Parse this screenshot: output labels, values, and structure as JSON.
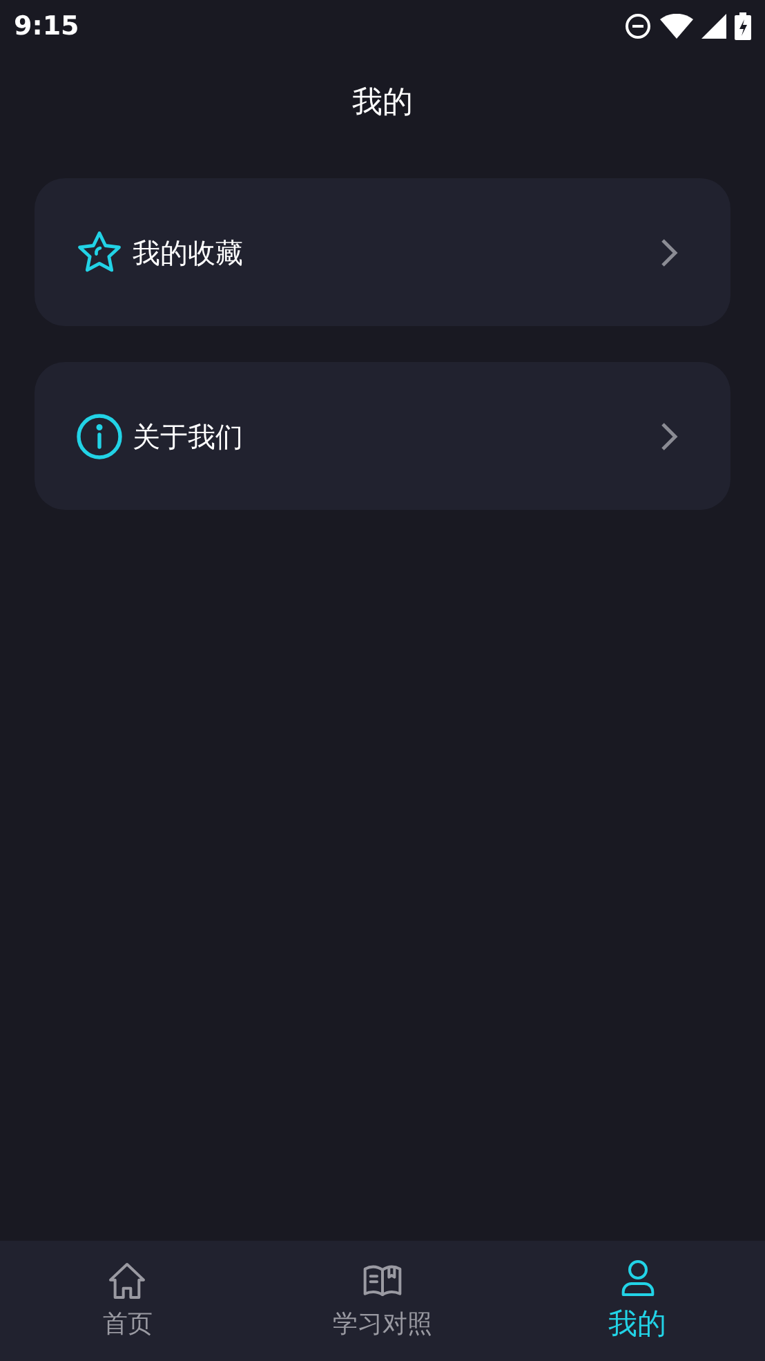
{
  "status_bar": {
    "time": "9:15"
  },
  "header": {
    "title": "我的"
  },
  "menu": [
    {
      "kind": "star",
      "label": "我的收藏"
    },
    {
      "kind": "info",
      "label": "关于我们"
    }
  ],
  "bottom_nav": [
    {
      "kind": "home",
      "label": "首页",
      "selected": false
    },
    {
      "kind": "book",
      "label": "学习对照",
      "selected": false
    },
    {
      "kind": "person",
      "label": "我的",
      "selected": true
    }
  ]
}
